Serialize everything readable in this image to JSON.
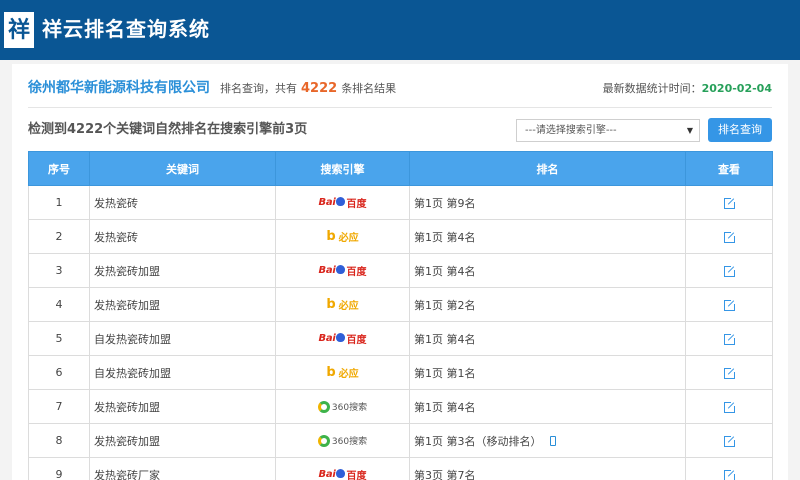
{
  "header": {
    "logo_char": "祥",
    "app_title": "祥云排名查询系统"
  },
  "summary": {
    "company": "徐州都华新能源科技有限公司",
    "prefix": "排名查询，共有",
    "count": "4222",
    "suffix": "条排名结果",
    "update_label": "最新数据统计时间：",
    "update_date": "2020-02-04"
  },
  "toolbar": {
    "headline": "检测到4222个关键词自然排名在搜索引擎前3页",
    "select_value": "---请选择搜索引擎---",
    "query_label": "排名查询"
  },
  "table": {
    "columns": [
      "序号",
      "关键词",
      "搜索引擎",
      "排名",
      "查看"
    ],
    "rows": [
      {
        "no": "1",
        "keyword": "发热瓷砖",
        "engine": "baidu",
        "rank": "第1页 第9名",
        "mobile": false
      },
      {
        "no": "2",
        "keyword": "发热瓷砖",
        "engine": "bing",
        "rank": "第1页 第4名",
        "mobile": false
      },
      {
        "no": "3",
        "keyword": "发热瓷砖加盟",
        "engine": "baidu",
        "rank": "第1页 第4名",
        "mobile": false
      },
      {
        "no": "4",
        "keyword": "发热瓷砖加盟",
        "engine": "bing",
        "rank": "第1页 第2名",
        "mobile": false
      },
      {
        "no": "5",
        "keyword": "自发热瓷砖加盟",
        "engine": "baidu",
        "rank": "第1页 第4名",
        "mobile": false
      },
      {
        "no": "6",
        "keyword": "自发热瓷砖加盟",
        "engine": "bing",
        "rank": "第1页 第1名",
        "mobile": false
      },
      {
        "no": "7",
        "keyword": "发热瓷砖加盟",
        "engine": "360",
        "rank": "第1页 第4名",
        "mobile": false
      },
      {
        "no": "8",
        "keyword": "发热瓷砖加盟",
        "engine": "360",
        "rank": "第1页 第3名（移动排名）",
        "mobile": true
      },
      {
        "no": "9",
        "keyword": "发热瓷砖厂家",
        "engine": "baidu",
        "rank": "第3页 第7名",
        "mobile": false
      }
    ]
  },
  "engine_logos": {
    "baidu": {
      "left": "Bai",
      "right": "百度"
    },
    "bing": {
      "mark": "b",
      "text": "必应"
    },
    "360": {
      "text": "360搜索"
    }
  },
  "colors": {
    "topbar": "#0a5694",
    "accent": "#3596e6",
    "table_header": "#4aa4ec",
    "count": "#e8672a",
    "date": "#27a05a"
  }
}
